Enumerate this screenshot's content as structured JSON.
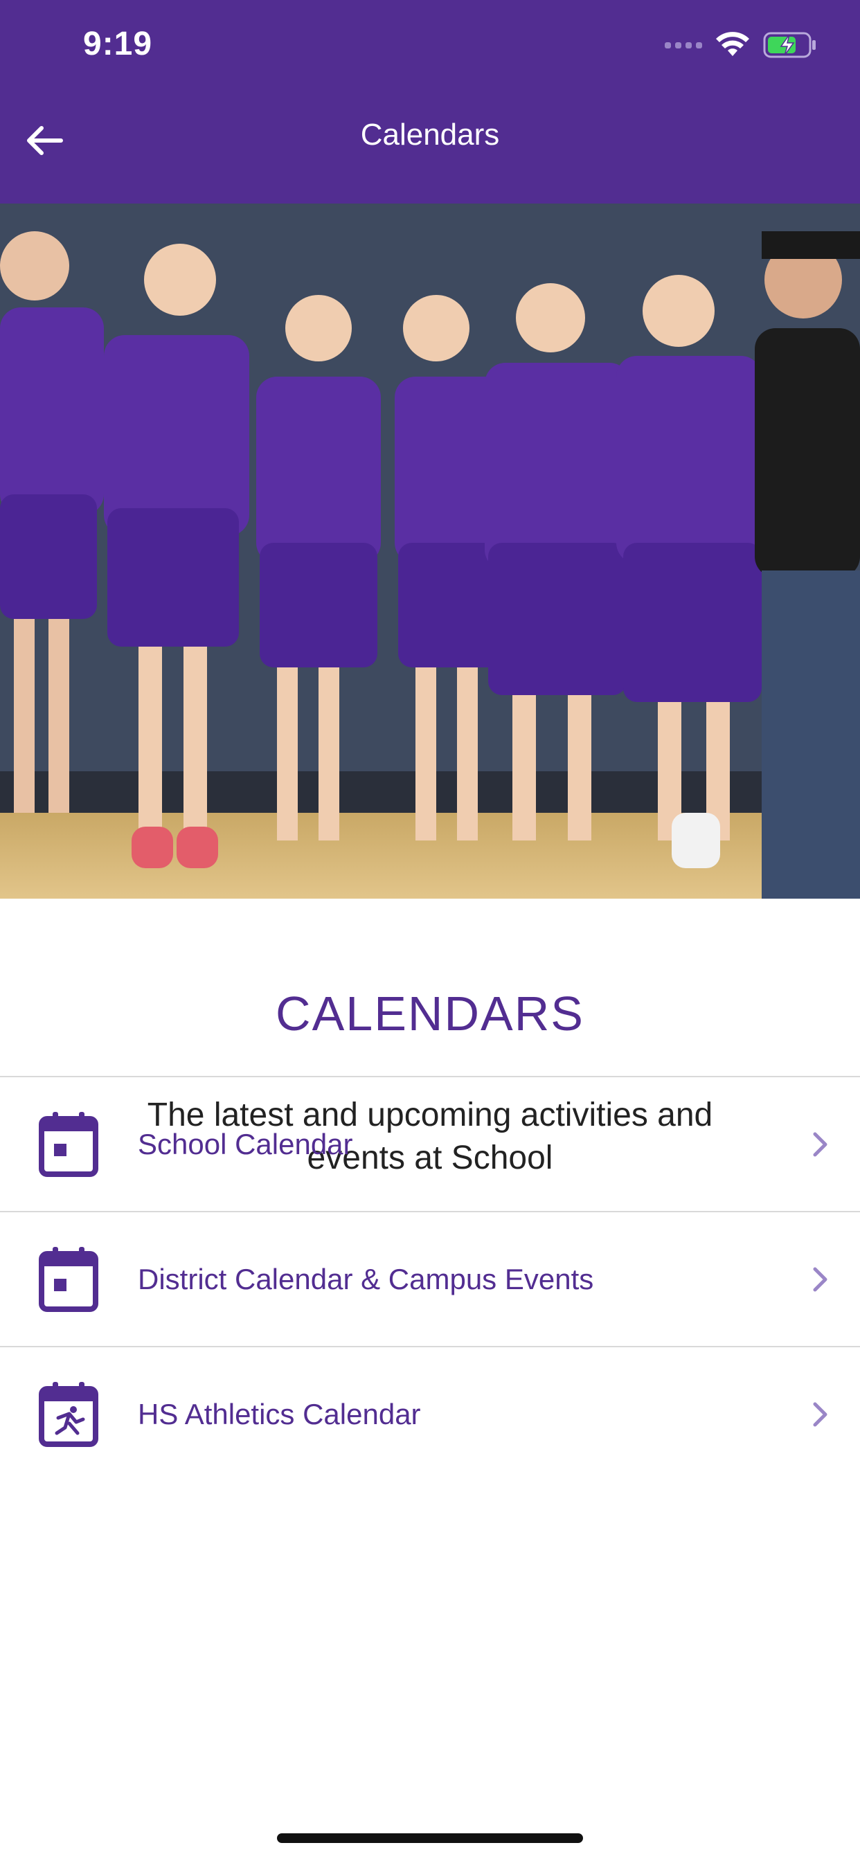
{
  "status_bar": {
    "time": "9:19"
  },
  "header": {
    "title": "Calendars"
  },
  "hero": {
    "image_alt": "Team photo of girls basketball players in purple jerseys"
  },
  "section": {
    "title": "CALENDARS",
    "subtitle": "The latest and upcoming activities and events at School"
  },
  "calendars": [
    {
      "label": "School Calendar",
      "icon": "calendar-icon"
    },
    {
      "label": "District Calendar & Campus Events",
      "icon": "calendar-icon"
    },
    {
      "label": "HS Athletics Calendar",
      "icon": "athletics-calendar-icon"
    }
  ],
  "colors": {
    "brand": "#522d91",
    "chevron": "#9a86c7",
    "divider": "#d9d9d9"
  }
}
